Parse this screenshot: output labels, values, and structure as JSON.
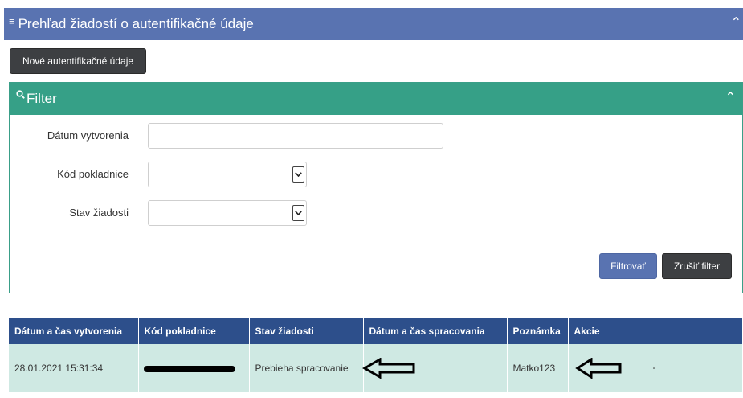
{
  "header": {
    "title": "Prehľad žiadostí o autentifikačné údaje"
  },
  "toolbar": {
    "new_label": "Nové autentifikačné údaje"
  },
  "filter": {
    "title": "Filter",
    "fields": [
      {
        "label": "Dátum vytvorenia",
        "type": "text",
        "value": ""
      },
      {
        "label": "Kód pokladnice",
        "type": "select",
        "value": ""
      },
      {
        "label": "Stav žiadosti",
        "type": "select",
        "value": ""
      }
    ],
    "apply_label": "Filtrovať",
    "reset_label": "Zrušiť filter"
  },
  "table": {
    "columns": [
      "Dátum a čas vytvorenia",
      "Kód pokladnice",
      "Stav žiadosti",
      "Dátum a čas spracovania",
      "Poznámka",
      "Akcie"
    ],
    "rows": [
      {
        "created": "28.01.2021 15:31:34",
        "code": "",
        "status": "Prebieha spracovanie",
        "processed": "",
        "note": "Matko123",
        "actions": "-"
      }
    ]
  },
  "colors": {
    "header_bg": "#5973b1",
    "filter_bg": "#36a087",
    "table_header_bg": "#2d4f8b",
    "row_bg": "#cfe9e3",
    "dark_button": "#3d3f42"
  }
}
